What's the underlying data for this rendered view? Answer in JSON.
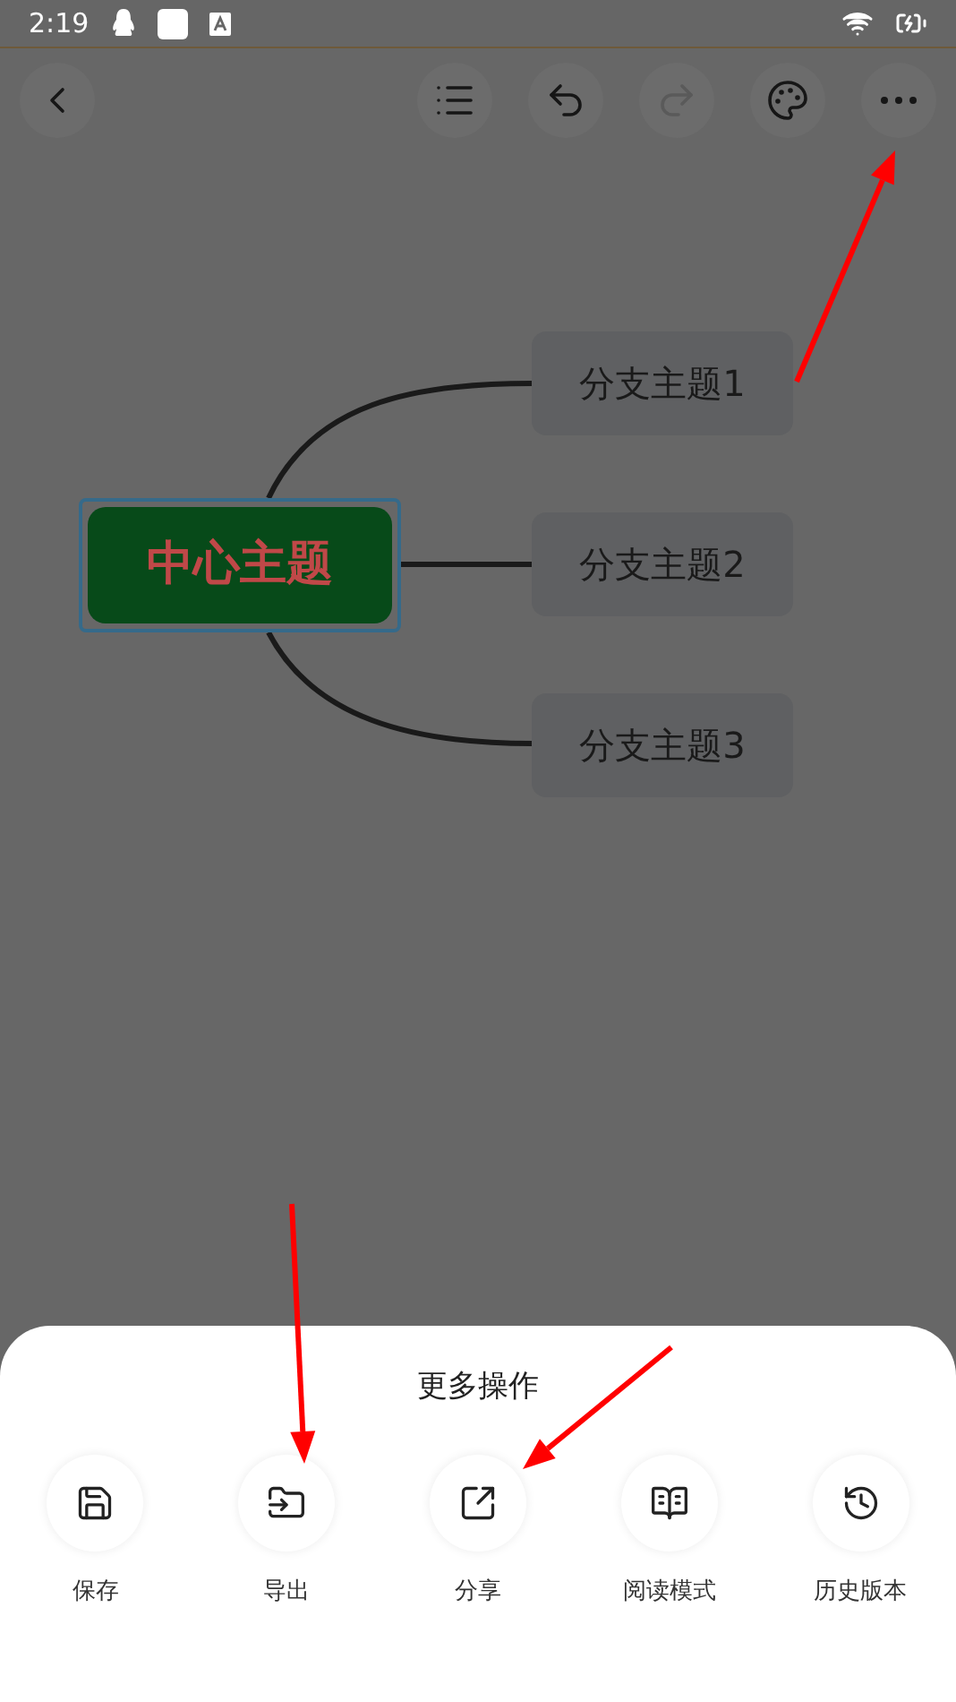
{
  "status_bar": {
    "time": "2:19"
  },
  "toolbar": [
    {
      "kind": "back",
      "disabled": false
    },
    {
      "kind": "outline",
      "disabled": false
    },
    {
      "kind": "undo",
      "disabled": false
    },
    {
      "kind": "redo",
      "disabled": true
    },
    {
      "kind": "theme",
      "disabled": false
    },
    {
      "kind": "more",
      "disabled": false
    }
  ],
  "mind_map": {
    "central": {
      "text": "中心主题",
      "selected": true
    },
    "branches": [
      {
        "text": "分支主题1"
      },
      {
        "text": "分支主题2"
      },
      {
        "text": "分支主题3"
      }
    ]
  },
  "sheet": {
    "title": "更多操作",
    "actions": [
      {
        "label": "保存",
        "kind": "save"
      },
      {
        "label": "导出",
        "kind": "export"
      },
      {
        "label": "分享",
        "kind": "share"
      },
      {
        "label": "阅读模式",
        "kind": "read"
      },
      {
        "label": "历史版本",
        "kind": "history"
      }
    ]
  }
}
